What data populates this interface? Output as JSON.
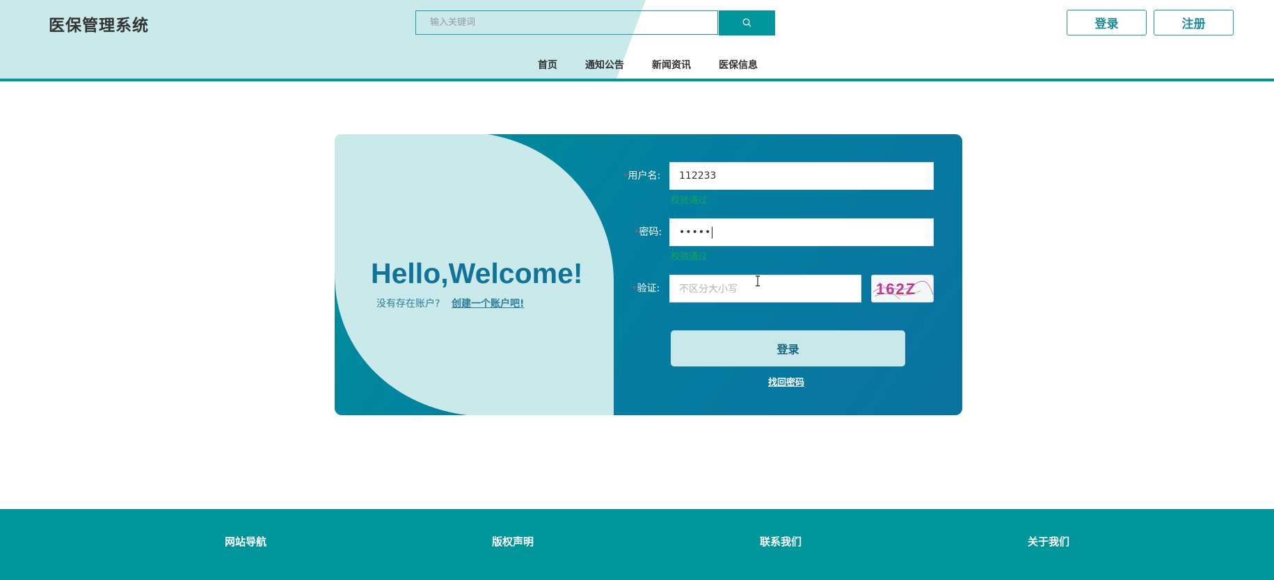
{
  "header": {
    "title": "医保管理系统",
    "search": {
      "placeholder": "输入关键词",
      "value": ""
    },
    "login_label": "登录",
    "register_label": "注册",
    "nav": [
      {
        "label": "首页"
      },
      {
        "label": "通知公告"
      },
      {
        "label": "新闻资讯"
      },
      {
        "label": "医保信息"
      }
    ]
  },
  "login_card": {
    "welcome": "Hello,Welcome!",
    "no_account": "没有存在账户?",
    "create_account": "创建一个账户吧!",
    "username": {
      "label": "用户名:",
      "value": "112233",
      "hint": "校验通过"
    },
    "password": {
      "label": "密码:",
      "value": "•••••",
      "hint": "校验通过"
    },
    "captcha": {
      "label": "验证:",
      "placeholder": "不区分大小写",
      "code": "162Z"
    },
    "submit_label": "登录",
    "forgot_label": "找回密码"
  },
  "footer": {
    "items": [
      {
        "label": "网站导航"
      },
      {
        "label": "版权声明"
      },
      {
        "label": "联系我们"
      },
      {
        "label": "关于我们"
      }
    ]
  },
  "colors": {
    "primary": "#00949b",
    "header_tint": "#c9e9eb",
    "card_dark": "#0a72a0",
    "success": "#12a65a"
  }
}
